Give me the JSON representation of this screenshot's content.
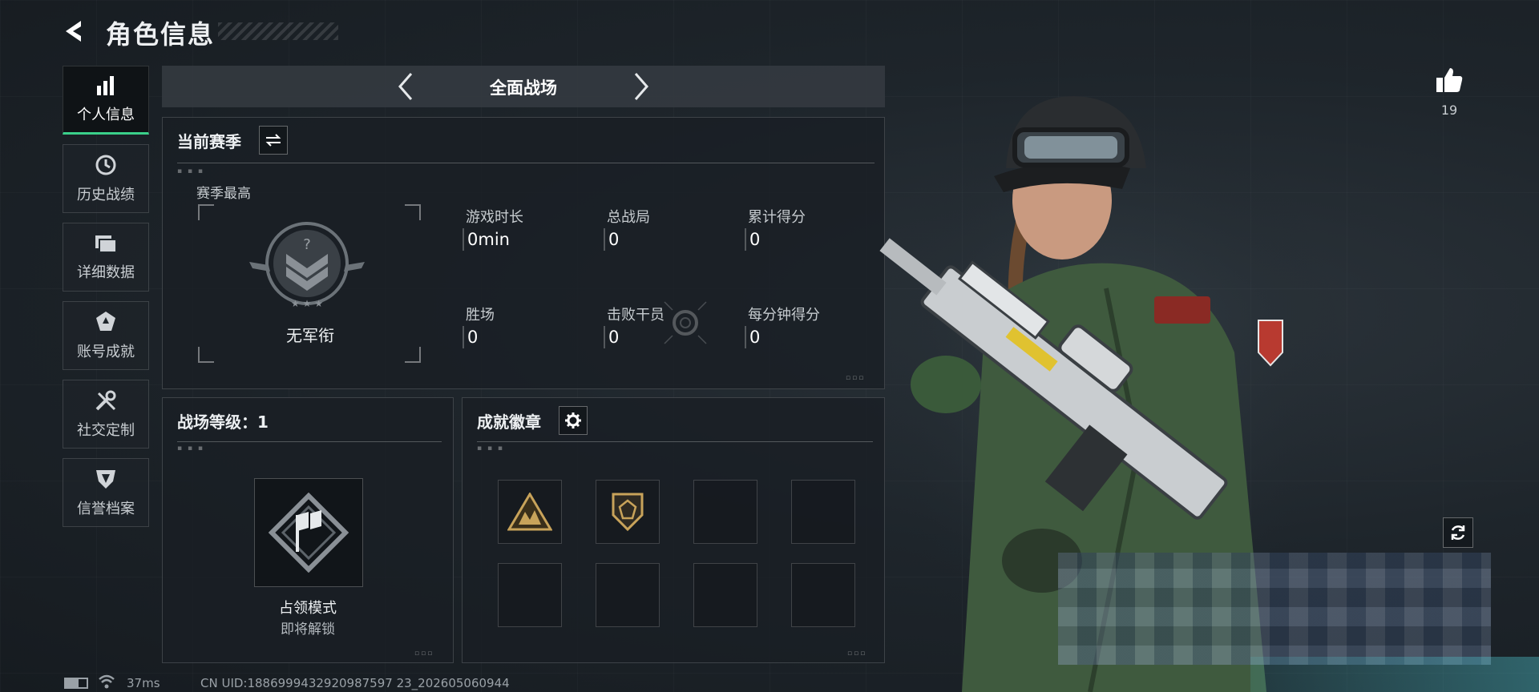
{
  "header": {
    "title": "角色信息"
  },
  "sidebar": {
    "items": [
      {
        "label": "个人信息",
        "icon": "bar-chart-icon",
        "active": true
      },
      {
        "label": "历史战绩",
        "icon": "clock-history-icon",
        "active": false
      },
      {
        "label": "详细数据",
        "icon": "folder-icon",
        "active": false
      },
      {
        "label": "账号成就",
        "icon": "achievement-icon",
        "active": false
      },
      {
        "label": "社交定制",
        "icon": "wrench-icon",
        "active": false
      },
      {
        "label": "信誉档案",
        "icon": "shield-icon",
        "active": false
      }
    ]
  },
  "mode_selector": {
    "label": "全面战场"
  },
  "season": {
    "title": "当前赛季",
    "best_label": "赛季最高",
    "rank_name": "无军衔",
    "stats": [
      {
        "label": "游戏时长",
        "value": "0min"
      },
      {
        "label": "总战局",
        "value": "0"
      },
      {
        "label": "累计得分",
        "value": "0"
      },
      {
        "label": "胜场",
        "value": "0"
      },
      {
        "label": "击败干员",
        "value": "0"
      },
      {
        "label": "每分钟得分",
        "value": "0"
      }
    ]
  },
  "battlefield_level": {
    "title": "战场等级：1",
    "mode_name": "占领模式",
    "mode_status": "即将解锁"
  },
  "achievements": {
    "title": "成就徽章"
  },
  "likes": {
    "count": "19"
  },
  "status_bar": {
    "ping": "37ms",
    "uid": "CN UID:1886999432920987597 23_202605060944"
  },
  "colors": {
    "accent": "#3ad08a",
    "badge_gold": "#c8a35a"
  }
}
